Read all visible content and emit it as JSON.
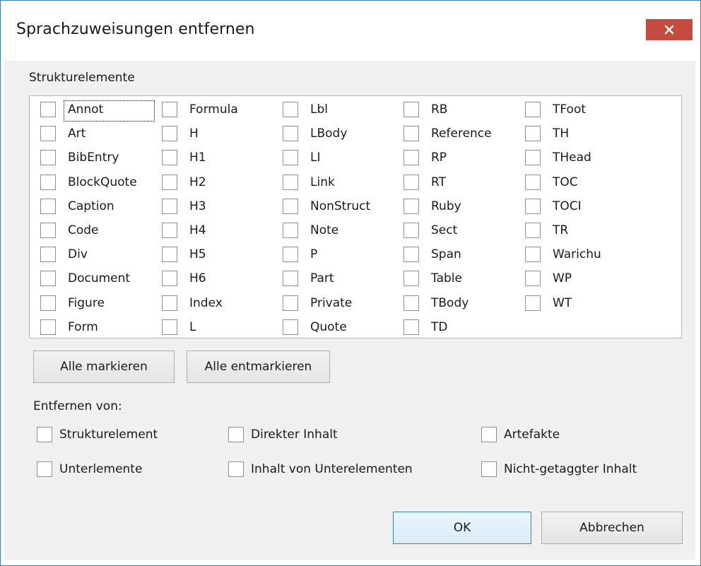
{
  "window": {
    "title": "Sprachzuweisungen entfernen"
  },
  "structure_group": {
    "label": "Strukturelemente",
    "columns": [
      [
        "Annot",
        "Art",
        "BibEntry",
        "BlockQuote",
        "Caption",
        "Code",
        "Div",
        "Document",
        "Figure",
        "Form"
      ],
      [
        "Formula",
        "H",
        "H1",
        "H2",
        "H3",
        "H4",
        "H5",
        "H6",
        "Index",
        "L"
      ],
      [
        "Lbl",
        "LBody",
        "LI",
        "Link",
        "NonStruct",
        "Note",
        "P",
        "Part",
        "Private",
        "Quote"
      ],
      [
        "RB",
        "Reference",
        "RP",
        "RT",
        "Ruby",
        "Sect",
        "Span",
        "Table",
        "TBody",
        "TD"
      ],
      [
        "TFoot",
        "TH",
        "THead",
        "TOC",
        "TOCI",
        "TR",
        "Warichu",
        "WP",
        "WT"
      ]
    ]
  },
  "buttons": {
    "select_all": "Alle markieren",
    "deselect_all": "Alle entmarkieren",
    "ok": "OK",
    "cancel": "Abbrechen"
  },
  "remove_from": {
    "label": "Entfernen von:",
    "options": [
      "Strukturelement",
      "Direkter Inhalt",
      "Artefakte",
      "Unterlemente",
      "Inhalt von Unterelementen",
      "Nicht-getaggter Inhalt"
    ]
  },
  "colors": {
    "window_border": "#3c82c8",
    "close_button": "#c74a3f",
    "client_background": "#f0f0f0"
  }
}
